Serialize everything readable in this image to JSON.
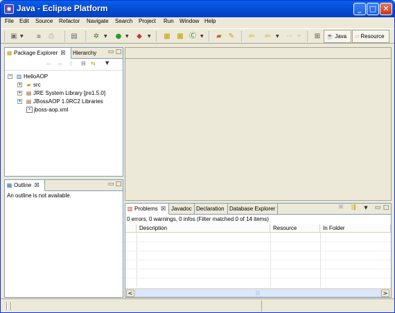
{
  "window": {
    "title": "Java - Eclipse Platform",
    "minimize": "_",
    "maximize": "□",
    "close": "✕"
  },
  "menu": [
    "File",
    "Edit",
    "Source",
    "Refactor",
    "Navigate",
    "Search",
    "Project",
    "Run",
    "Window",
    "Help"
  ],
  "perspectives": {
    "java": "Java",
    "resource": "Resource"
  },
  "package_explorer": {
    "tabs": [
      "Package Explorer",
      "Hierarchy"
    ],
    "tree": [
      {
        "label": "HelloAOP",
        "icon": "project-icon"
      },
      {
        "label": "src",
        "icon": "source-folder-icon"
      },
      {
        "label": "JRE System Library [jre1.5.0]",
        "icon": "library-icon"
      },
      {
        "label": "JBossAOP 1.0RC2 Libraries",
        "icon": "library-icon"
      },
      {
        "label": "jboss-aop.xml",
        "icon": "xml-file-icon"
      }
    ]
  },
  "outline": {
    "tab": "Outline",
    "message": "An outline is not available."
  },
  "problems": {
    "tabs": [
      "Problems",
      "Javadoc",
      "Declaration",
      "Database Explorer"
    ],
    "summary": "0 errors, 0 warnings, 0 infos (Filter matched 0 of 14 items)",
    "columns": [
      "Description",
      "Resource",
      "In Folder"
    ]
  },
  "scrollbar": {
    "left": "<",
    "right": ">",
    "grip": "|||"
  }
}
